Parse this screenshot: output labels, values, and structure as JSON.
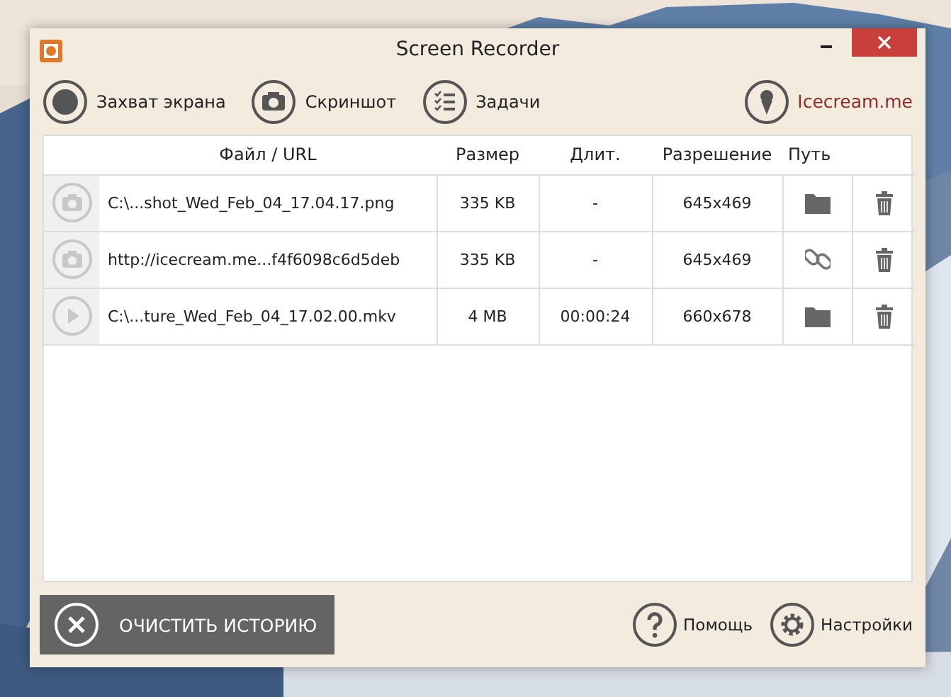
{
  "window": {
    "title": "Screen Recorder"
  },
  "toolbar": [
    {
      "label": "Захват экрана",
      "kind": "record"
    },
    {
      "label": "Скриншот",
      "kind": "camera"
    },
    {
      "label": "Задачи",
      "kind": "tasks"
    }
  ],
  "brand_link": "Icecream.me",
  "table": {
    "columns": [
      "Файл / URL",
      "Размер",
      "Длит.",
      "Разрешение",
      "Путь"
    ],
    "rows": [
      {
        "file": "C:\\...shot_Wed_Feb_04_17.04.17.png",
        "size": "335 KB",
        "duration": "-",
        "resolution": "645x469",
        "path": {
          "kind": "folder"
        }
      },
      {
        "file": "http://icecream.me...f4f6098c6d5deb",
        "size": "335 KB",
        "duration": "-",
        "resolution": "645x469",
        "path": {
          "kind": "link"
        }
      },
      {
        "kind": "video",
        "file": "C:\\...ture_Wed_Feb_04_17.02.00.mkv",
        "size": "4 MB",
        "duration": "00:00:24",
        "resolution": "660x678",
        "path": {
          "kind": "folder"
        }
      }
    ]
  },
  "clear_button": "ОЧИСТИТЬ ИСТОРИЮ",
  "footer_links": [
    {
      "label": "Помощь",
      "kind": "help"
    },
    {
      "label": "Настройки",
      "kind": "settings"
    }
  ]
}
